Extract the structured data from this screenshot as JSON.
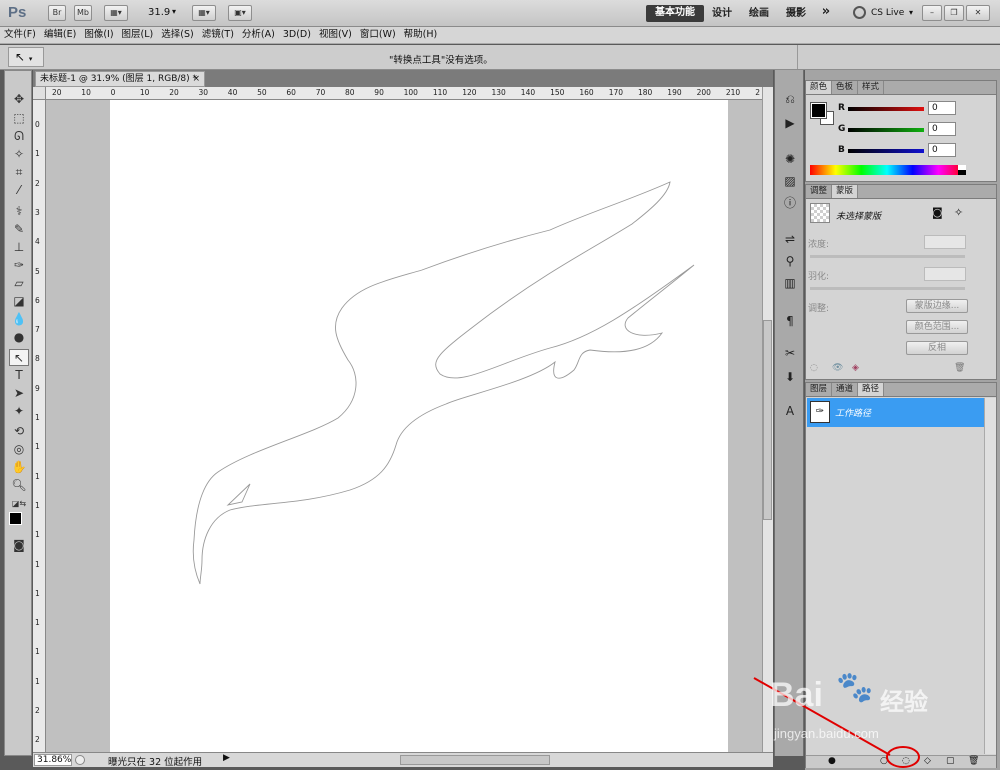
{
  "app": {
    "logo": "Ps",
    "bridge_label": "Br",
    "minibridge_label": "Mb",
    "zoom_value": "31.9",
    "workspaces": [
      "基本功能",
      "设计",
      "绘画",
      "摄影"
    ],
    "more_label": "»",
    "cslive_label": "CS Live"
  },
  "menu": [
    "文件(F)",
    "编辑(E)",
    "图像(I)",
    "图层(L)",
    "选择(S)",
    "滤镜(T)",
    "分析(A)",
    "3D(D)",
    "视图(V)",
    "窗口(W)",
    "帮助(H)"
  ],
  "options_bar": {
    "tool_icon": "convert-point-icon",
    "message": "\"转换点工具\"没有选项。"
  },
  "document": {
    "tab_title": "未标题-1 @ 31.9% (图层 1, RGB/8) *",
    "close_label": "×",
    "ruler_h": [
      "20",
      "10",
      "0",
      "10",
      "20",
      "30",
      "40",
      "50",
      "60",
      "70",
      "80",
      "90",
      "100",
      "110",
      "120",
      "130",
      "140",
      "150",
      "160",
      "170",
      "180",
      "190",
      "200",
      "210",
      "2"
    ],
    "ruler_v": [
      "0",
      "1",
      "2",
      "3",
      "4",
      "5",
      "6",
      "7",
      "8",
      "9",
      "1",
      "1",
      "1",
      "1",
      "1",
      "1",
      "1",
      "1",
      "1",
      "1",
      "2",
      "2",
      "2"
    ],
    "status_zoom": "31.86%",
    "status_text": "曝光只在 32 位起作用"
  },
  "color_panel": {
    "tabs": [
      "颜色",
      "色板",
      "样式"
    ],
    "channels": [
      {
        "label": "R",
        "value": "0",
        "color": "#e01010"
      },
      {
        "label": "G",
        "value": "0",
        "color": "#10b010"
      },
      {
        "label": "B",
        "value": "0",
        "color": "#1010d0"
      }
    ]
  },
  "masks_panel": {
    "tabs": [
      "调整",
      "蒙版"
    ],
    "no_mask": "未选择蒙版",
    "density_label": "浓度:",
    "feather_label": "羽化:",
    "refine_label": "调整:",
    "buttons": [
      "蒙版边缘...",
      "颜色范围...",
      "反相"
    ]
  },
  "paths_panel": {
    "tabs": [
      "图层",
      "通道",
      "路径"
    ],
    "rows": [
      "工作路径"
    ]
  },
  "watermark": {
    "brand": "Bai",
    "brand_cn": "经验",
    "url": "jingyan.baidu.com"
  }
}
